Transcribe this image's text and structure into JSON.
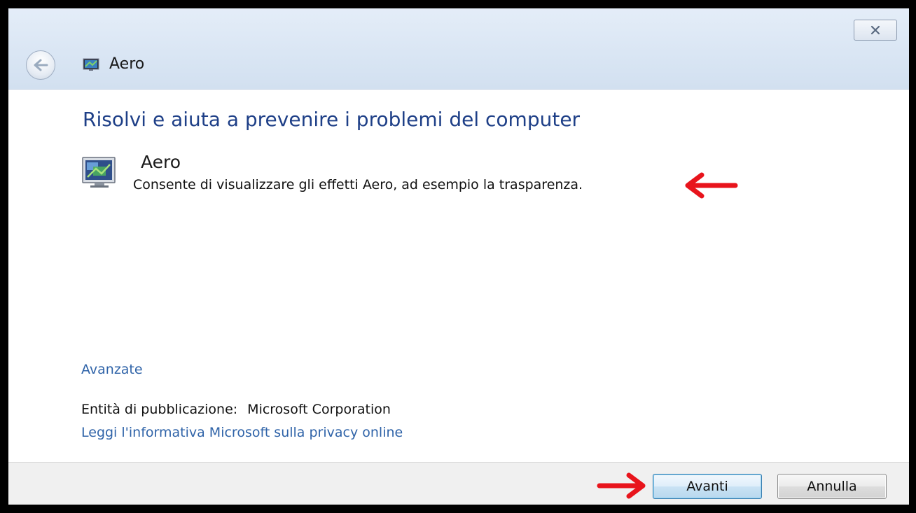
{
  "window": {
    "title": "Aero",
    "close_icon": "close-icon",
    "back_icon": "back-arrow-icon",
    "app_icon": "troubleshooter-icon"
  },
  "main": {
    "heading": "Risolvi e aiuta a prevenire i problemi del computer",
    "item": {
      "title": "Aero",
      "description": "Consente di visualizzare gli effetti Aero, ad esempio la trasparenza.",
      "icon": "aero-monitor-icon"
    },
    "advanced_link": "Avanzate",
    "publisher_label": "Entità di pubblicazione:",
    "publisher_value": "Microsoft Corporation",
    "privacy_link": "Leggi l'informativa Microsoft sulla privacy online"
  },
  "footer": {
    "next_label": "Avanti",
    "cancel_label": "Annulla"
  },
  "annotations": {
    "arrow_color": "#e8141c",
    "arrow_icon": "red-arrow-icon"
  }
}
